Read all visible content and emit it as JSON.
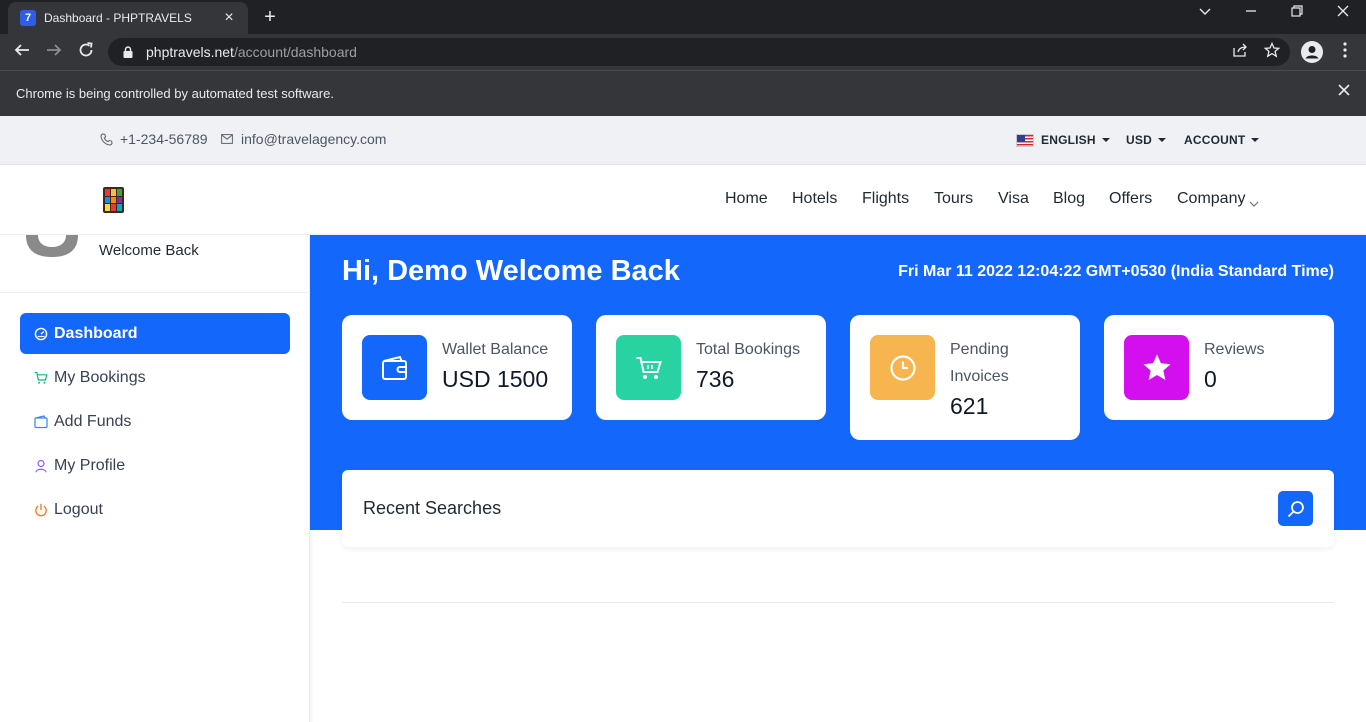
{
  "browser": {
    "tab_title": "Dashboard - PHPTRAVELS",
    "favicon_letter": "7",
    "url_host": "phptravels.net",
    "url_path": "/account/dashboard",
    "infobar_message": "Chrome is being controlled by automated test software."
  },
  "topbar": {
    "phone": "+1-234-56789",
    "email": "info@travelagency.com",
    "language": "ENGLISH",
    "currency": "USD",
    "account": "ACCOUNT"
  },
  "nav": {
    "items": [
      "Home",
      "Hotels",
      "Flights",
      "Tours",
      "Visa",
      "Blog",
      "Offers",
      "Company"
    ]
  },
  "sidebar": {
    "welcome": "Welcome Back",
    "items": [
      {
        "label": "Dashboard",
        "icon": "gauge-icon",
        "active": true
      },
      {
        "label": "My Bookings",
        "icon": "cart-icon",
        "color": "#10b981"
      },
      {
        "label": "Add Funds",
        "icon": "wallet-icon",
        "color": "#3b82f6"
      },
      {
        "label": "My Profile",
        "icon": "user-icon",
        "color": "#8b5cf6"
      },
      {
        "label": "Logout",
        "icon": "power-icon",
        "color": "#f97316"
      }
    ]
  },
  "dashboard": {
    "greeting": "Hi, Demo Welcome Back",
    "datetime": "Fri Mar 11 2022 12:04:22 GMT+0530 (India Standard Time)",
    "stats": [
      {
        "label": "Wallet Balance",
        "value": "USD 1500",
        "color": "#1467fb",
        "icon": "wallet-icon"
      },
      {
        "label": "Total Bookings",
        "value": "736",
        "color": "#28d3a1",
        "icon": "cart-icon"
      },
      {
        "label": "Pending Invoices",
        "value": "621",
        "color": "#f7b54f",
        "icon": "clock-icon"
      },
      {
        "label": "Reviews",
        "value": "0",
        "color": "#d30ff0",
        "icon": "star-icon"
      }
    ],
    "recent_searches_title": "Recent Searches"
  },
  "colors": {
    "primary": "#1467fb",
    "chrome_dark": "#202124",
    "chrome_mid": "#35363a"
  }
}
